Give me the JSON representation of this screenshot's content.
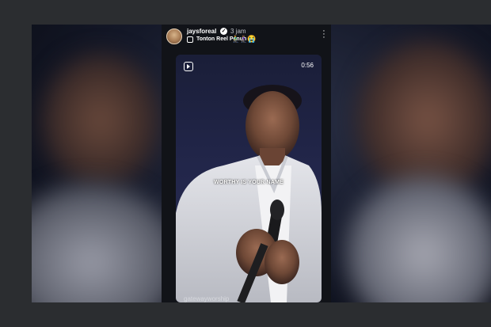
{
  "story": {
    "username": "jaysforeal",
    "time": "3 jam",
    "reel_link": "Tonton Reel Penuh",
    "emojis": "🧎‍♂️🧎🏾‍♀️😭",
    "video": {
      "duration": "0:56",
      "caption": "WORTHY IS YOUR NAME",
      "credit": "gatewayworship"
    }
  },
  "icons": {
    "verified": "verified-badge-icon",
    "reel": "reel-icon",
    "more": "more-vertical-icon",
    "reels_logo": "reels-logo-icon"
  }
}
